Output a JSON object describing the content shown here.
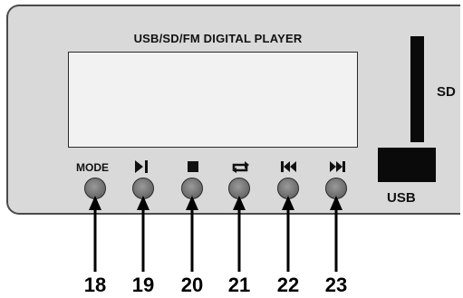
{
  "panel": {
    "title": "USB/SD/FM DIGITAL PLAYER",
    "sd_label": "SD",
    "usb_label": "USB"
  },
  "buttons": [
    {
      "label": "MODE",
      "icon": "mode-text",
      "callout": "18"
    },
    {
      "label": "",
      "icon": "play-pause-icon",
      "callout": "19"
    },
    {
      "label": "",
      "icon": "stop-icon",
      "callout": "20"
    },
    {
      "label": "",
      "icon": "repeat-icon",
      "callout": "21"
    },
    {
      "label": "",
      "icon": "previous-track-icon",
      "callout": "22"
    },
    {
      "label": "",
      "icon": "next-track-icon",
      "callout": "23"
    }
  ],
  "colors": {
    "panel": "#d9d9d9",
    "display": "#f2f2f2",
    "slot": "#0a0a0a",
    "button": "#6f6f6f"
  }
}
